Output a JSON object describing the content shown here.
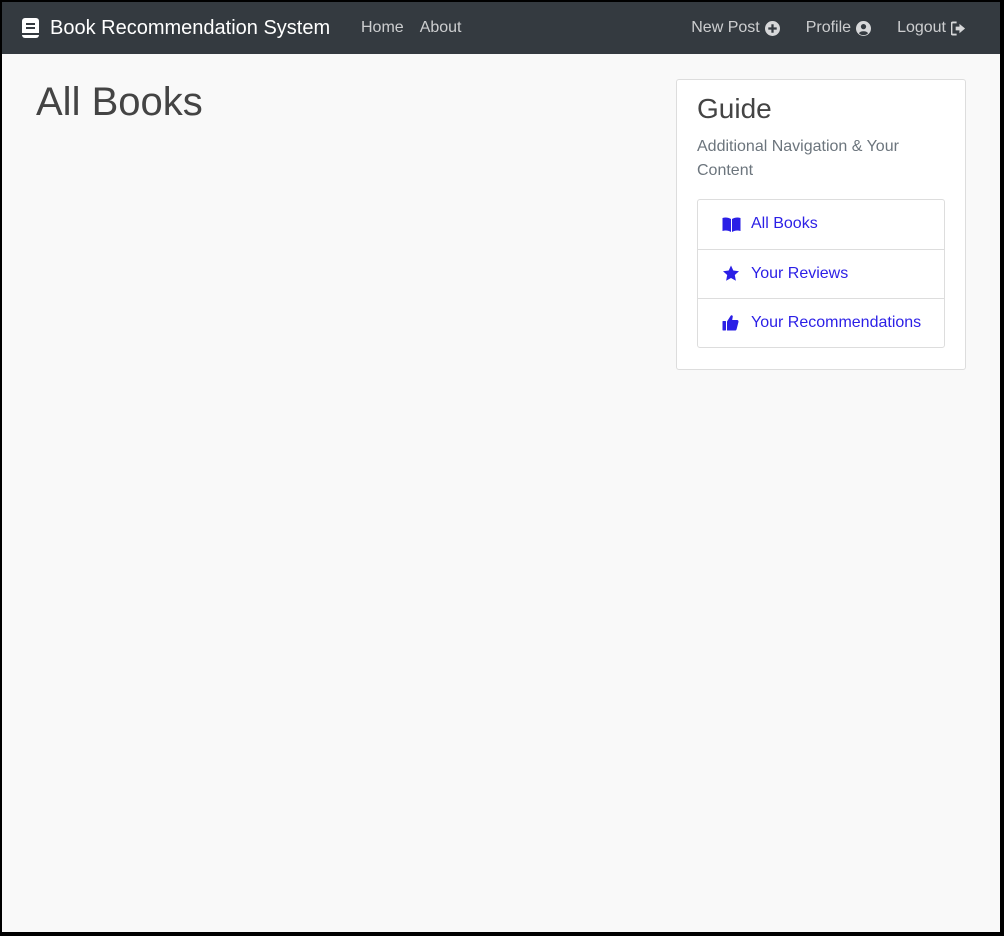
{
  "navbar": {
    "brand": "Book Recommendation System",
    "left_links": [
      {
        "label": "Home"
      },
      {
        "label": "About"
      }
    ],
    "right_links": [
      {
        "label": "New Post",
        "icon": "plus-circle-icon"
      },
      {
        "label": "Profile",
        "icon": "user-circle-icon"
      },
      {
        "label": "Logout",
        "icon": "sign-out-icon"
      }
    ]
  },
  "main": {
    "title": "All Books"
  },
  "guide": {
    "title": "Guide",
    "subtitle": "Additional Navigation & Your Content",
    "items": [
      {
        "label": "All Books",
        "icon": "open-book-icon"
      },
      {
        "label": "Your Reviews",
        "icon": "star-icon"
      },
      {
        "label": "Your Recommendations",
        "icon": "thumbs-up-icon"
      }
    ]
  },
  "colors": {
    "navbar_bg": "#343a40",
    "link_accent": "#2b1fe6",
    "page_bg": "#f9f9f9"
  }
}
